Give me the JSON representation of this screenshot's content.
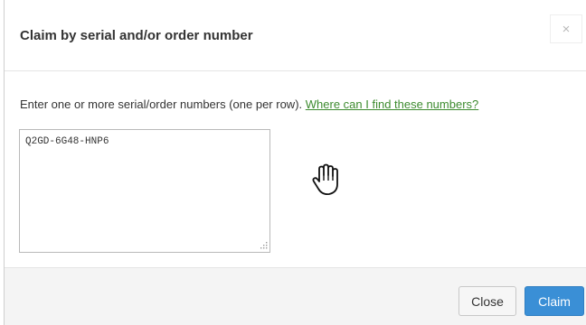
{
  "dialog": {
    "title": "Claim by serial and/or order number",
    "close_symbol": "×",
    "instructions": "Enter one or more serial/order numbers (one per row).",
    "help_link": "Where can I find these numbers?",
    "numbers_value": "Q2GD-6G48-HNP6",
    "close_button": "Close",
    "claim_button": "Claim"
  },
  "icons": {
    "dismiss": "close-icon",
    "pointer": "hand-cursor-icon",
    "grip": "resize-grip-icon"
  },
  "colors": {
    "link": "#3d8b2f",
    "primary": "#3a8fd6",
    "footer_bg": "#f4f4f4"
  }
}
